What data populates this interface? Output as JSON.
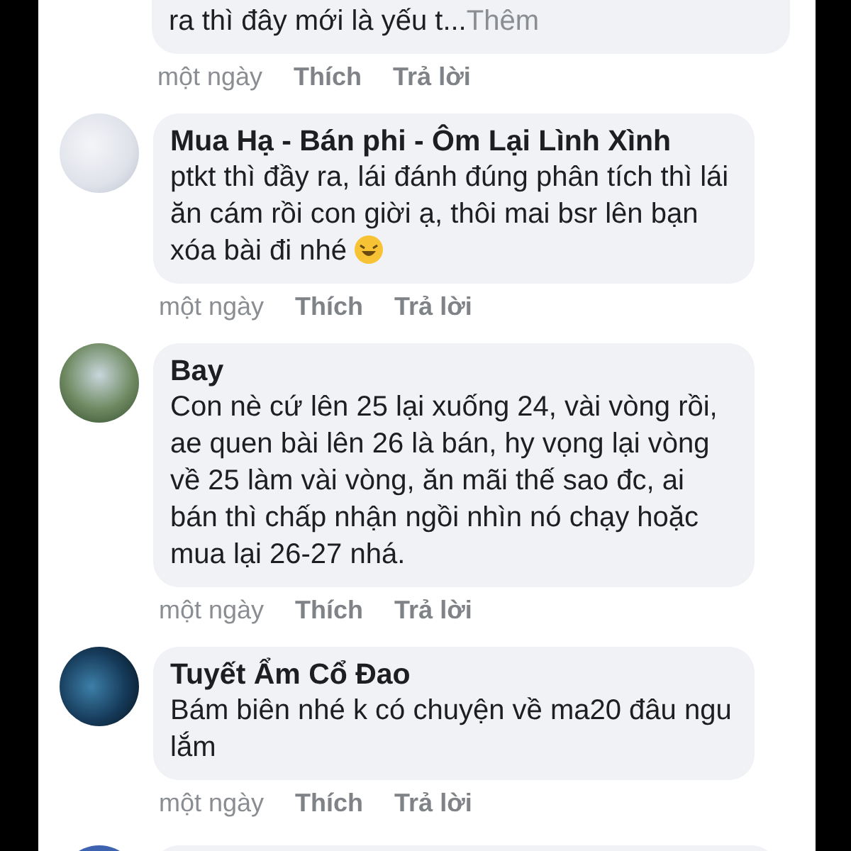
{
  "top_comment": {
    "text": "ra thì đây mới là yếu t...",
    "more_link": "Thêm",
    "time": "một ngày",
    "like": "Thích",
    "reply": "Trả lời"
  },
  "comments": [
    {
      "name": "Mua Hạ - Bán phi - Ôm Lại Lình Xình",
      "text": "ptkt thì đầy ra, lái đánh đúng phân tích thì lái ăn cám rồi con giời ạ, thôi mai bsr lên bạn xóa bài đi nhé",
      "emoji": true,
      "time": "một ngày",
      "like": "Thích",
      "reply": "Trả lời"
    },
    {
      "name": "Bay",
      "text": "Con nè cứ lên 25 lại xuống 24, vài vòng rồi, ae quen bài lên 26 là bán, hy vọng lại vòng về 25 làm vài vòng, ăn mãi thế sao đc, ai bán thì chấp nhận ngồi nhìn nó chạy hoặc mua lại 26-27 nhá.",
      "emoji": false,
      "time": "một ngày",
      "like": "Thích",
      "reply": "Trả lời"
    },
    {
      "name": "Tuyết Ẩm Cổ Đao",
      "text": "Bám biên nhé k có chuyện về ma20 đâu ngu lắm",
      "emoji": false,
      "time": "một ngày",
      "like": "Thích",
      "reply": "Trả lời"
    }
  ]
}
